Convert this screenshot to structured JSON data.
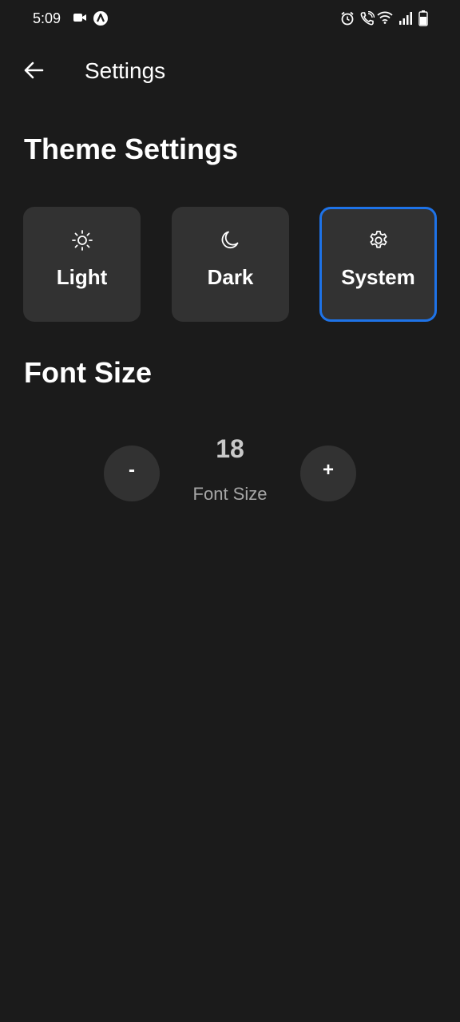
{
  "status_bar": {
    "time": "5:09",
    "left_icons": [
      "video-camera-icon",
      "app-notification-icon"
    ],
    "right_icons": [
      "alarm-icon",
      "wifi-call-icon",
      "wifi-icon",
      "signal-icon",
      "battery-icon"
    ]
  },
  "app_bar": {
    "back_icon": "arrow-left-icon",
    "title": "Settings"
  },
  "theme_section": {
    "heading": "Theme Settings",
    "options": [
      {
        "label": "Light",
        "icon": "sun-icon",
        "selected": false
      },
      {
        "label": "Dark",
        "icon": "moon-icon",
        "selected": false
      },
      {
        "label": "System",
        "icon": "gear-icon",
        "selected": true
      }
    ],
    "selected_border_color": "#1e73e8"
  },
  "font_section": {
    "heading": "Font Size",
    "decrease_label": "-",
    "increase_label": "+",
    "value": "18",
    "caption": "Font Size"
  },
  "colors": {
    "background": "#1b1b1b",
    "card": "#323232",
    "accent": "#1e73e8"
  }
}
